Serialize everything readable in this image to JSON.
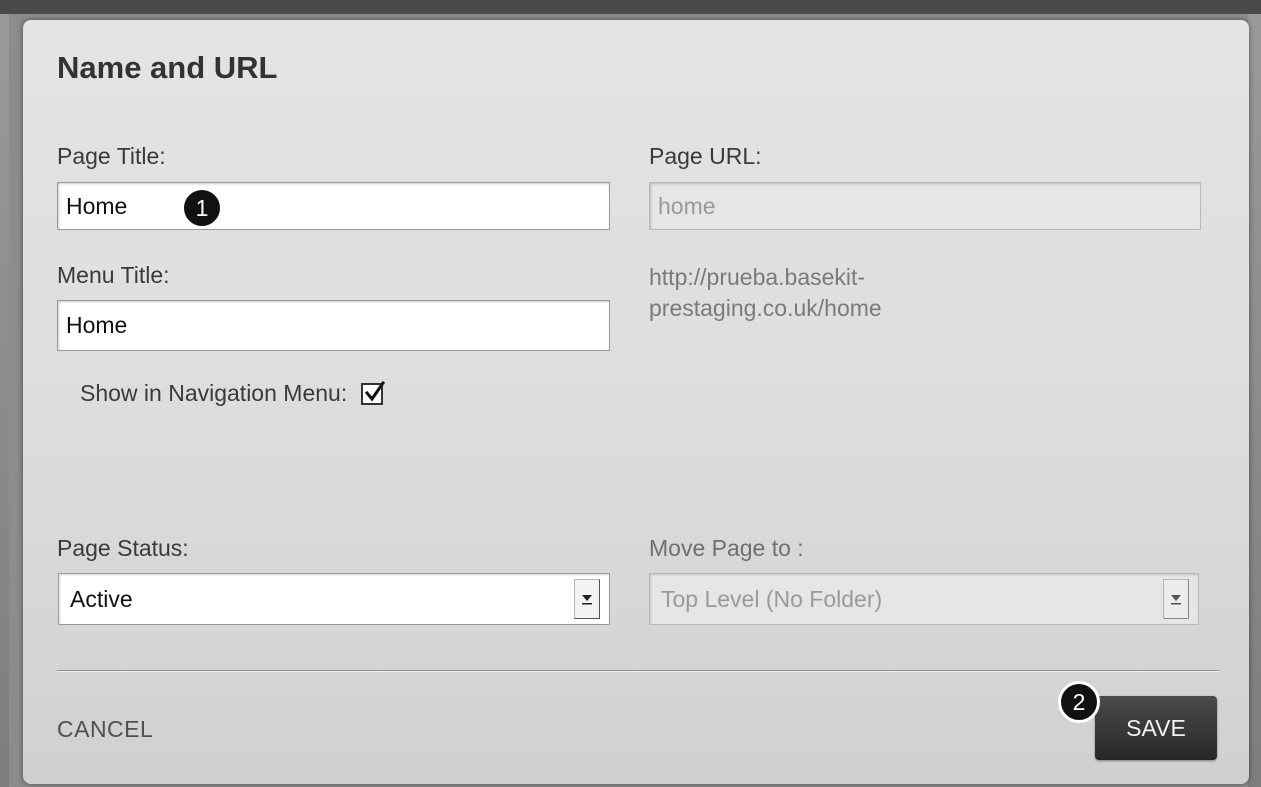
{
  "dialog": {
    "title": "Name and URL"
  },
  "page_title": {
    "label": "Page Title:",
    "value": "Home"
  },
  "page_url": {
    "label": "Page URL:",
    "value": "home",
    "full_url_line1": "http://prueba.basekit-",
    "full_url_line2": "prestaging.co.uk/home"
  },
  "menu_title": {
    "label": "Menu Title:",
    "value": "Home"
  },
  "navigation": {
    "label": "Show in Navigation Menu:",
    "checked": true
  },
  "page_status": {
    "label": "Page Status:",
    "selected": "Active"
  },
  "move_page": {
    "label": "Move Page to :",
    "selected": "Top Level (No Folder)"
  },
  "footer": {
    "cancel_label": "CANCEL",
    "save_label": "SAVE"
  },
  "markers": {
    "first": "1",
    "second": "2"
  }
}
